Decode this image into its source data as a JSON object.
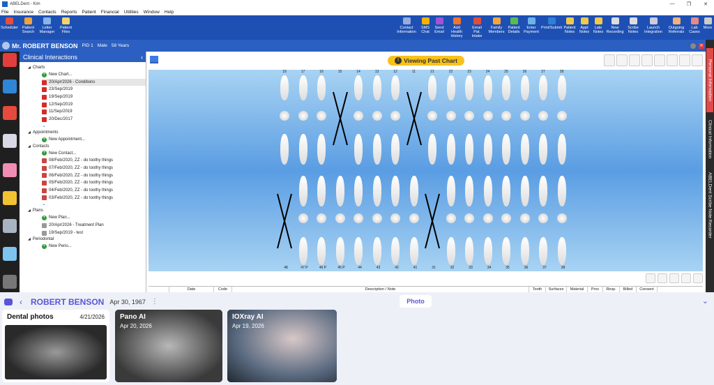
{
  "window": {
    "title": "ABELDent - Kim"
  },
  "menu": [
    "File",
    "Insurance",
    "Contacts",
    "Reports",
    "Patient",
    "Financial",
    "Utilities",
    "Window",
    "Help"
  ],
  "toolbar_left": [
    {
      "label": "Scheduler",
      "color": "#e84d3d"
    },
    {
      "label": "Patient Search",
      "color": "#f2a33a"
    },
    {
      "label": "Letter Manager",
      "color": "#8ab4e8"
    },
    {
      "label": "Patient Files",
      "color": "#f4d36b"
    }
  ],
  "toolbar_right": [
    {
      "label": "Contact Information",
      "color": "#9ad"
    },
    {
      "label": "SMS Chat",
      "color": "#f5b300"
    },
    {
      "label": "Send Email",
      "color": "#a055d0"
    },
    {
      "label": "Add Health History",
      "color": "#f0752b"
    },
    {
      "label": "Email Pat. Intake",
      "color": "#e04e3a"
    },
    {
      "label": "Family Members",
      "color": "#f3a63b"
    },
    {
      "label": "Patient Details",
      "color": "#5cbb4e"
    },
    {
      "label": "Enter Payment",
      "color": "#6bb3e5"
    },
    {
      "label": "Print/Submit",
      "color": "#2f7fd6"
    },
    {
      "label": "Patient Notes",
      "color": "#f2c84b"
    },
    {
      "label": "Appt Notes",
      "color": "#f2c84b"
    },
    {
      "label": "Late Notes",
      "color": "#f2c84b"
    },
    {
      "label": "New Recording",
      "color": "#ddd"
    },
    {
      "label": "Scribe Notes",
      "color": "#ddd"
    },
    {
      "label": "Launch Integration",
      "color": "#ccd"
    },
    {
      "label": "Outgoing Referrals",
      "color": "#f3b07b"
    },
    {
      "label": "Lab Cases",
      "color": "#e48a8a"
    },
    {
      "label": "More",
      "color": "#ccc"
    }
  ],
  "patient": {
    "name": "Mr. ROBERT BENSON",
    "pid": "PID 1",
    "sex": "Male",
    "age": "58 Years"
  },
  "rail": [
    "Personal Information",
    "Clinical Information",
    "ABELDent Scribe Note Recorder"
  ],
  "tree": {
    "title": "Clinical Interactions",
    "sections": [
      {
        "name": "Charts",
        "items": [
          {
            "kind": "add",
            "text": "New Chart..."
          },
          {
            "kind": "chart",
            "text": "20/Apr/2026 - Conditions",
            "sel": true
          },
          {
            "kind": "chart",
            "text": "23/Sep/2019"
          },
          {
            "kind": "chart",
            "text": "19/Sep/2019"
          },
          {
            "kind": "chart",
            "text": "12/Sep/2019"
          },
          {
            "kind": "chart",
            "text": "11/Sep/2019"
          },
          {
            "kind": "chart",
            "text": "20/Dec/2017"
          }
        ],
        "more": true
      },
      {
        "name": "Appointments",
        "items": [
          {
            "kind": "add",
            "text": "New Appointment..."
          }
        ]
      },
      {
        "name": "Contacts",
        "items": [
          {
            "kind": "add",
            "text": "New Contact..."
          },
          {
            "kind": "contact",
            "text": "08/Feb/2020, ZZ - do toothy things"
          },
          {
            "kind": "contact",
            "text": "07/Feb/2020, ZZ - do toothy things"
          },
          {
            "kind": "contact",
            "text": "06/Feb/2020, ZZ - do toothy things"
          },
          {
            "kind": "contact",
            "text": "05/Feb/2020, ZZ - do toothy things"
          },
          {
            "kind": "contact",
            "text": "04/Feb/2020, ZZ - do toothy things"
          },
          {
            "kind": "contact",
            "text": "03/Feb/2020, ZZ - do toothy things"
          }
        ],
        "more": true
      },
      {
        "name": "Plans",
        "items": [
          {
            "kind": "add",
            "text": "New Plan..."
          },
          {
            "kind": "plan",
            "text": "20/Apr/2026 - Treatment Plan"
          },
          {
            "kind": "plan",
            "text": "19/Sep/2019 - test"
          }
        ]
      },
      {
        "name": "Periodontal",
        "items": [
          {
            "kind": "add",
            "text": "New Perio..."
          }
        ]
      }
    ]
  },
  "viewing_label": "Viewing Past Chart",
  "upper_numbers": [
    "18",
    "17",
    "16",
    "15",
    "14",
    "13",
    "12",
    "11",
    "21",
    "22",
    "23",
    "24",
    "25",
    "26",
    "27",
    "28"
  ],
  "lower_numbers": [
    "48",
    "47 P",
    "46 P",
    "45 P",
    "44",
    "43",
    "42",
    "41",
    "31",
    "32",
    "33",
    "34",
    "35",
    "36",
    "37",
    "38"
  ],
  "grid_columns": [
    "",
    "Date",
    "Code",
    "Description / Note",
    "Tooth",
    "Surfaces",
    "Material",
    "Prov",
    "Resp.",
    "Billed",
    "Consent"
  ],
  "bottom": {
    "patient_name": "ROBERT BENSON",
    "dob": "Apr 30, 1967",
    "photo_button": "Photo",
    "cards": [
      {
        "title": "Dental photos",
        "date": "4/21/2026"
      },
      {
        "title": "Pano AI",
        "date": "Apr 20, 2026"
      },
      {
        "title": "IOXray AI",
        "date": "Apr 19, 2026"
      }
    ]
  }
}
